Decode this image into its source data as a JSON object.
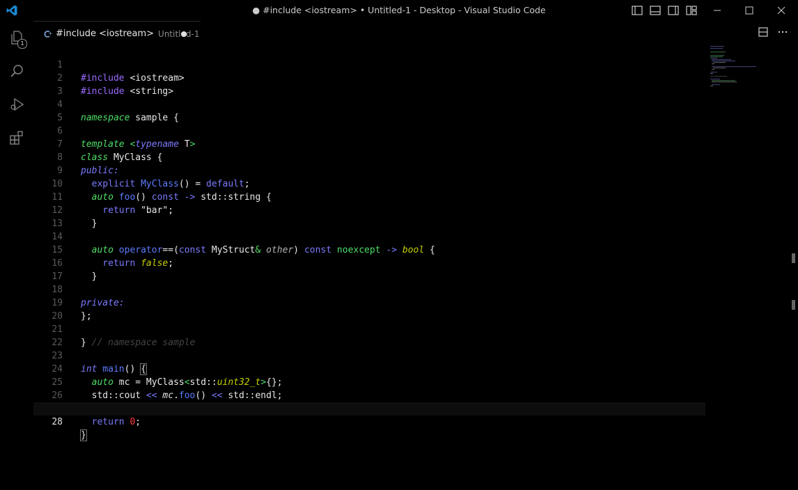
{
  "window": {
    "title": "● #include <iostream> • Untitled-1 - Desktop - Visual Studio Code"
  },
  "activity": {
    "explorer_badge": "1"
  },
  "tab": {
    "name": "#include <iostream>",
    "description": "Untitled-1"
  },
  "editor": {
    "active_line": "28",
    "lines": [
      {
        "n": "1"
      },
      {
        "n": "2"
      },
      {
        "n": "3"
      },
      {
        "n": "4"
      },
      {
        "n": "5"
      },
      {
        "n": "6"
      },
      {
        "n": "7"
      },
      {
        "n": "8"
      },
      {
        "n": "9"
      },
      {
        "n": "10"
      },
      {
        "n": "11"
      },
      {
        "n": "12"
      },
      {
        "n": "13"
      },
      {
        "n": "14"
      },
      {
        "n": "15"
      },
      {
        "n": "16"
      },
      {
        "n": "17"
      },
      {
        "n": "18"
      },
      {
        "n": "19"
      },
      {
        "n": "20"
      },
      {
        "n": "21"
      },
      {
        "n": "22"
      },
      {
        "n": "23"
      },
      {
        "n": "24"
      },
      {
        "n": "25"
      },
      {
        "n": "26"
      },
      {
        "n": "27"
      },
      {
        "n": "28"
      }
    ]
  },
  "tokens": {
    "l1_a": "#include ",
    "l1_b": "<iostream>",
    "l2_a": "#include ",
    "l2_b": "<string>",
    "l4_a": "namespace",
    "l4_b": " sample {",
    "l6_a": "template",
    "l6_b": " <",
    "l6_c": "typename",
    "l6_d": " T",
    "l6_e": ">",
    "l7_a": "class",
    "l7_b": " MyClass {",
    "l8": "public:",
    "l9_a": "  explicit ",
    "l9_b": "MyClass",
    "l9_c": "() = ",
    "l9_d": "default",
    "l9_e": ";",
    "l10_a": "  auto ",
    "l10_b": "foo",
    "l10_c": "() ",
    "l10_d": "const",
    "l10_e": " -> ",
    "l10_f": "std::string {",
    "l11_a": "    return ",
    "l11_b": "\"bar\"",
    "l11_c": ";",
    "l12": "  }",
    "l14_a": "  auto ",
    "l14_b": "operator",
    "l14_c": "==(",
    "l14_d": "const",
    "l14_e": " MyStruct",
    "l14_f": "&",
    "l14_g": " other",
    "l14_h": ") ",
    "l14_i": "const",
    "l14_j": " noexcept",
    "l14_k": " -> ",
    "l14_l": "bool",
    "l14_m": " {",
    "l15_a": "    return ",
    "l15_b": "false",
    "l15_c": ";",
    "l16": "  }",
    "l18": "private:",
    "l19": "};",
    "l21_a": "} ",
    "l21_b": "// namespace sample",
    "l23_a": "int",
    "l23_b": " main",
    "l23_c": "() ",
    "l23_d": "{",
    "l24_a": "  auto ",
    "l24_b": "mc = MyClass",
    "l24_c": "<",
    "l24_d": "std::",
    "l24_e": "uint32_t",
    "l24_f": ">",
    "l24_g": "{};",
    "l25_a": "  std::cout ",
    "l25_b": "<<",
    "l25_c": " mc",
    "l25_d": ".",
    "l25_e": "foo",
    "l25_f": "() ",
    "l25_g": "<<",
    "l25_h": " std::endl;",
    "l27_a": "  return ",
    "l27_b": "0",
    "l27_c": ";",
    "l28": "}"
  },
  "colors": {
    "background": "#000000",
    "keyword_green": "#4fde68",
    "keyword_blue": "#7b7bff",
    "type_yellow": "#c6d000",
    "number_red": "#ff3b3b",
    "comment": "#444444"
  }
}
